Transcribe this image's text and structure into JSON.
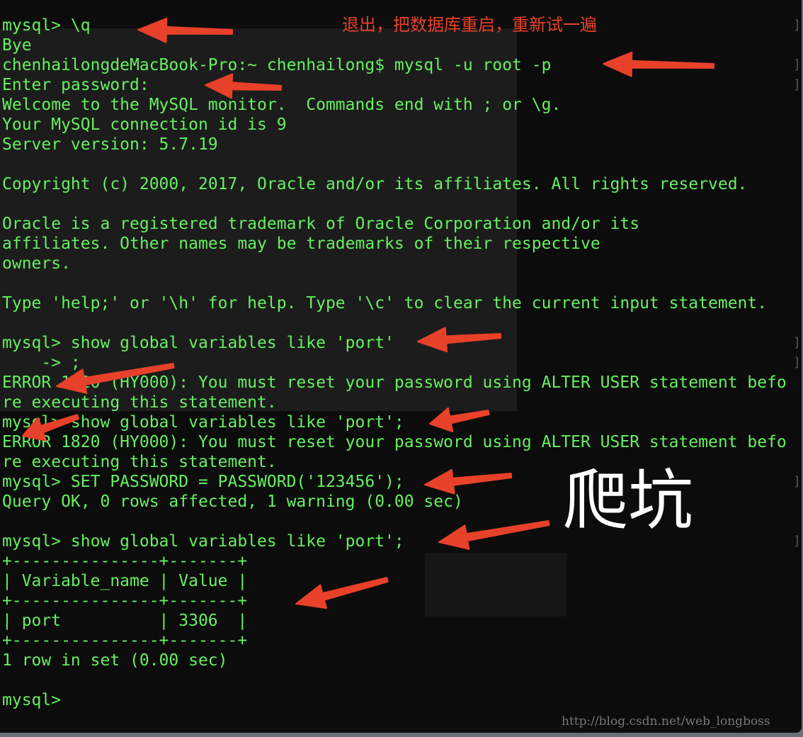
{
  "terminal": {
    "lines": [
      "mysql> \\q",
      "Bye",
      "chenhailongdeMacBook-Pro:~ chenhailong$ mysql -u root -p",
      "Enter password:",
      "Welcome to the MySQL monitor.  Commands end with ; or \\g.",
      "Your MySQL connection id is 9",
      "Server version: 5.7.19",
      "",
      "Copyright (c) 2000, 2017, Oracle and/or its affiliates. All rights reserved.",
      "",
      "Oracle is a registered trademark of Oracle Corporation and/or its",
      "affiliates. Other names may be trademarks of their respective",
      "owners.",
      "",
      "Type 'help;' or '\\h' for help. Type '\\c' to clear the current input statement.",
      "",
      "mysql> show global variables like 'port'",
      "    -> ;",
      "ERROR 1820 (HY000): You must reset your password using ALTER USER statement befo",
      "re executing this statement.",
      "mysql> show global variables like 'port';",
      "ERROR 1820 (HY000): You must reset your password using ALTER USER statement befo",
      "re executing this statement.",
      "mysql> SET PASSWORD = PASSWORD('123456');",
      "Query OK, 0 rows affected, 1 warning (0.00 sec)",
      "",
      "mysql> show global variables like 'port';",
      "+---------------+-------+",
      "| Variable_name | Value |",
      "+---------------+-------+",
      "| port          | 3306  |",
      "+---------------+-------+",
      "1 row in set (0.00 sec)",
      "",
      "mysql> "
    ],
    "wrap_marker": "]"
  },
  "annotations": {
    "note": "退出，把数据库重启，重新试一遍",
    "big_label": "爬坑",
    "arrow_color": "#e8412a"
  },
  "watermark": "http://blog.csdn.net/web_longboss"
}
